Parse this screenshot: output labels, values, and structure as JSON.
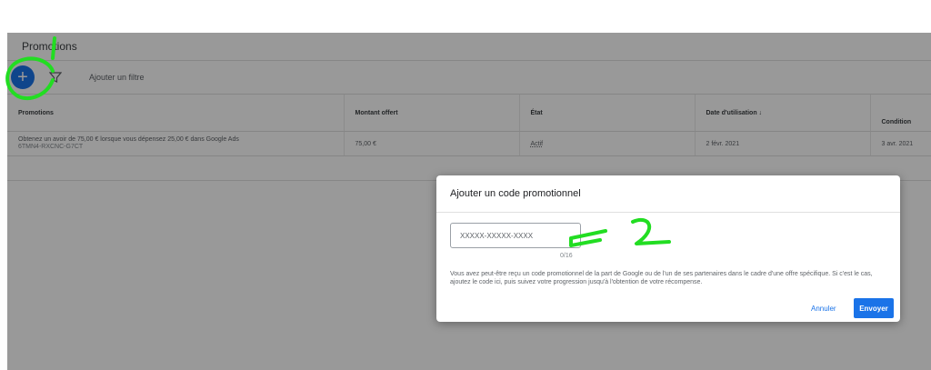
{
  "page": {
    "title": "Promotions"
  },
  "toolbar": {
    "add_icon": "plus-icon",
    "filter_icon": "filter-icon",
    "filter_label": "Ajouter un filtre"
  },
  "table": {
    "headers": [
      "Promotions",
      "Montant offert",
      "État",
      "Date d'utilisation ↓",
      "Condition"
    ],
    "rows": [
      {
        "description": "Obtenez un avoir de 75,00 € lorsque vous dépensez 25,00 € dans Google Ads",
        "code": "6TMN4-RXCNC-G7CT",
        "amount": "75,00 €",
        "status": "Actif",
        "date_used": "2 févr. 2021",
        "condition": "3 avr. 2021"
      }
    ]
  },
  "dialog": {
    "title": "Ajouter un code promotionnel",
    "input_placeholder": "XXXXX-XXXXX-XXXX",
    "char_count": "0/16",
    "description": "Vous avez peut-être reçu un code promotionnel de la part de Google ou de l'un de ses partenaires dans le cadre d'une offre spécifique. Si c'est le cas, ajoutez le code ici, puis suivez votre progression jusqu'à l'obtention de votre récompense.",
    "cancel_label": "Annuler",
    "submit_label": "Envoyer"
  },
  "colors": {
    "accent": "#1a73e8",
    "annotation": "#22dd22",
    "scrim": "rgba(0,0,0,0.40)"
  }
}
